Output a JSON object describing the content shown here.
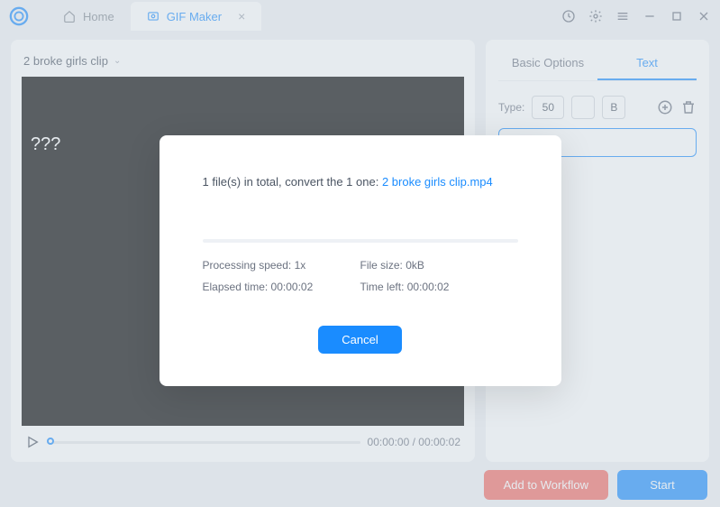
{
  "tabs": {
    "home": "Home",
    "gifmaker": "GIF Maker"
  },
  "dropdown": {
    "label": "2 broke girls clip"
  },
  "video": {
    "overlay_text": "???"
  },
  "player": {
    "current": "00:00:00",
    "total": "00:00:02"
  },
  "right": {
    "tabs": {
      "basic": "Basic Options",
      "text": "Text"
    },
    "type_label": "Type:",
    "font_size": "50",
    "bold_label": "B"
  },
  "footer": {
    "add_workflow": "Add to Workflow",
    "start": "Start"
  },
  "modal": {
    "prefix": "1 file(s) in total, convert the 1 one: ",
    "filename": "2 broke girls clip.mp4",
    "speed_label": "Processing speed: ",
    "speed_value": "1x",
    "elapsed_label": "Elapsed time: ",
    "elapsed_value": "00:00:02",
    "filesize_label": "File size: ",
    "filesize_value": "0kB",
    "timeleft_label": "Time left: ",
    "timeleft_value": "00:00:02",
    "cancel": "Cancel"
  }
}
